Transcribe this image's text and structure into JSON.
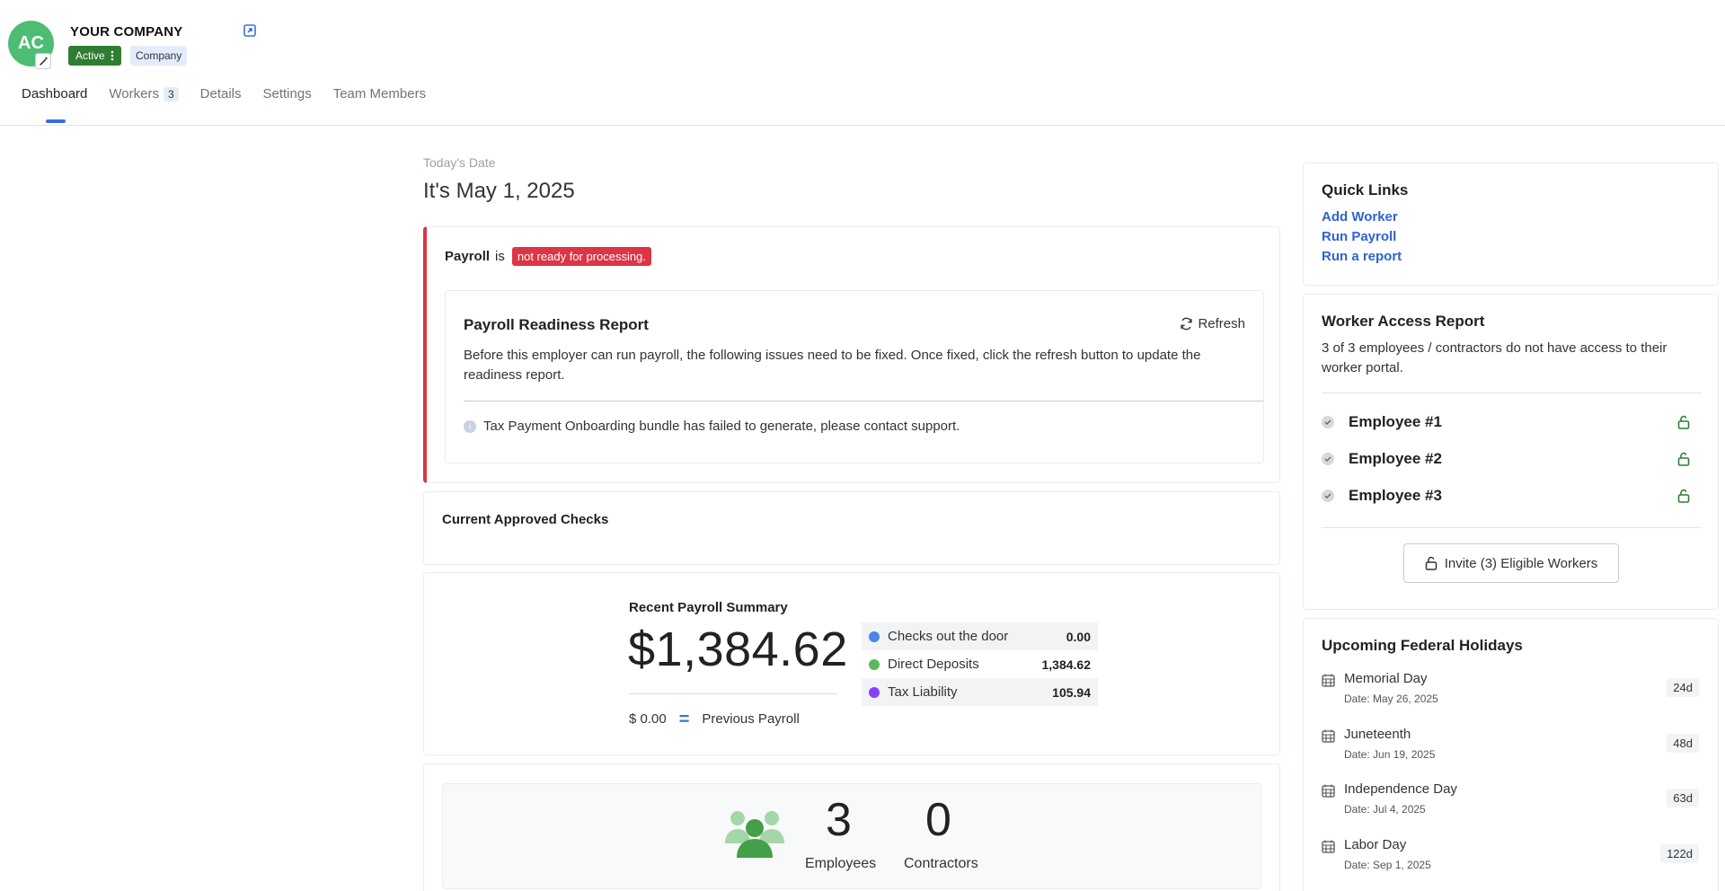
{
  "company": {
    "initials": "AC",
    "name": "YOUR COMPANY",
    "status": "Active",
    "type": "Company"
  },
  "tabs": [
    {
      "label": "Dashboard",
      "active": true
    },
    {
      "label": "Workers",
      "count": "3"
    },
    {
      "label": "Details"
    },
    {
      "label": "Settings"
    },
    {
      "label": "Team Members"
    }
  ],
  "today": {
    "label": "Today's Date",
    "text": "It's May 1, 2025"
  },
  "payroll": {
    "label": "Payroll",
    "connector": "is",
    "status": "not ready for processing.",
    "readiness": {
      "title": "Payroll Readiness Report",
      "refresh_label": "Refresh",
      "description": "Before this employer can run payroll, the following issues need to be fixed. Once fixed, click the refresh button to update the readiness report.",
      "issue": "Tax Payment Onboarding bundle has failed to generate, please contact support."
    }
  },
  "checks": {
    "title": "Current Approved Checks"
  },
  "summary": {
    "title": "Recent Payroll Summary",
    "amount": "$1,384.62",
    "previous_amount": "$ 0.00",
    "previous_label": "Previous Payroll",
    "breakdown": [
      {
        "label": "Checks out the door",
        "value": "0.00",
        "color": "#4a86e8"
      },
      {
        "label": "Direct Deposits",
        "value": "1,384.62",
        "color": "#5cb85c"
      },
      {
        "label": "Tax Liability",
        "value": "105.94",
        "color": "#8a3ffc"
      }
    ]
  },
  "workers": {
    "employees_count": "3",
    "employees_label": "Employees",
    "contractors_count": "0",
    "contractors_label": "Contractors"
  },
  "quick_links": {
    "title": "Quick Links",
    "links": [
      "Add Worker",
      "Run Payroll",
      "Run a report"
    ]
  },
  "worker_access": {
    "title": "Worker Access Report",
    "description": "3 of 3 employees / contractors do not have access to their worker portal.",
    "employees": [
      "Employee #1",
      "Employee #2",
      "Employee #3"
    ],
    "invite_label": "Invite (3) Eligible Workers"
  },
  "holidays": {
    "title": "Upcoming Federal Holidays",
    "items": [
      {
        "name": "Memorial Day",
        "date": "Date: May 26, 2025",
        "days": "24d"
      },
      {
        "name": "Juneteenth",
        "date": "Date: Jun 19, 2025",
        "days": "48d"
      },
      {
        "name": "Independence Day",
        "date": "Date: Jul 4, 2025",
        "days": "63d"
      },
      {
        "name": "Labor Day",
        "date": "Date: Sep 1, 2025",
        "days": "122d"
      }
    ]
  },
  "colors": {
    "accent": "#3b6fe0",
    "danger": "#dc3545",
    "success": "#2e7d32",
    "avatar": "#4dbd74",
    "link": "#2f63d3"
  }
}
